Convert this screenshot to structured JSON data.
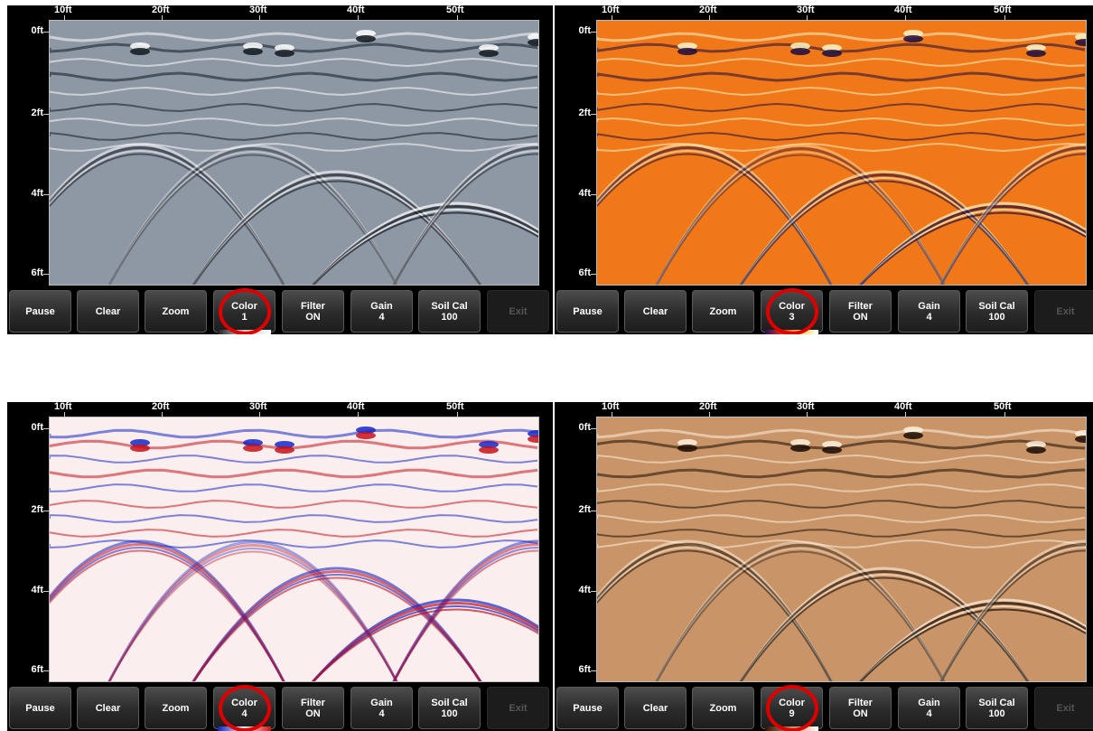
{
  "ruler_labels": [
    "10ft",
    "20ft",
    "30ft",
    "40ft",
    "50ft"
  ],
  "depth_labels": [
    "0ft",
    "2ft",
    "4ft",
    "6ft"
  ],
  "panels": [
    {
      "id": "p1",
      "buttons": {
        "pause": "Pause",
        "clear": "Clear",
        "zoom": "Zoom",
        "color_line1": "Color",
        "color_value": "1",
        "filter_line1": "Filter",
        "filter_value": "ON",
        "gain_line1": "Gain",
        "gain_value": "4",
        "soilcal_line1": "Soil Cal",
        "soilcal_value": "100",
        "exit": "Exit"
      },
      "palette": {
        "bg": "#8e98a4",
        "light": "#ffffff",
        "dark": "#111820",
        "mid": "#aab2bc"
      }
    },
    {
      "id": "p2",
      "buttons": {
        "pause": "Pause",
        "clear": "Clear",
        "zoom": "Zoom",
        "color_line1": "Color",
        "color_value": "3",
        "filter_line1": "Filter",
        "filter_value": "ON",
        "gain_line1": "Gain",
        "gain_value": "4",
        "soilcal_line1": "Soil Cal",
        "soilcal_value": "100",
        "exit": "Exit"
      },
      "palette": {
        "bg": "#f07818",
        "light": "#fff6c8",
        "dark": "#1a0a40",
        "mid": "#e65a10"
      }
    },
    {
      "id": "p3",
      "buttons": {
        "pause": "Pause",
        "clear": "Clear",
        "zoom": "Zoom",
        "color_line1": "Color",
        "color_value": "4",
        "filter_line1": "Filter",
        "filter_value": "ON",
        "gain_line1": "Gain",
        "gain_value": "4",
        "soilcal_line1": "Soil Cal",
        "soilcal_value": "100",
        "exit": "Exit"
      },
      "palette": {
        "bg": "#fbeeee",
        "light": "#1428c8",
        "dark": "#c8101a",
        "mid": "#f4d2d2"
      }
    },
    {
      "id": "p4",
      "buttons": {
        "pause": "Pause",
        "clear": "Clear",
        "zoom": "Zoom",
        "color_line1": "Color",
        "color_value": "9",
        "filter_line1": "Filter",
        "filter_value": "ON",
        "gain_line1": "Gain",
        "gain_value": "4",
        "soilcal_line1": "Soil Cal",
        "soilcal_value": "100",
        "exit": "Exit"
      },
      "palette": {
        "bg": "#c89468",
        "light": "#fff0dc",
        "dark": "#1a0c04",
        "mid": "#b07c52"
      }
    }
  ]
}
